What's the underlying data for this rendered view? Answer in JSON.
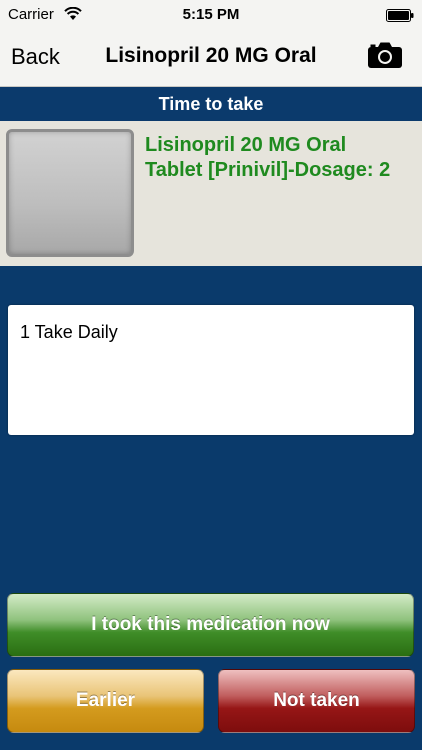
{
  "status_bar": {
    "carrier": "Carrier",
    "time": "5:15 PM"
  },
  "nav": {
    "back_label": "Back",
    "title": "Lisinopril 20 MG Oral",
    "camera_icon": "camera-icon"
  },
  "section": {
    "header": "Time to take"
  },
  "medication": {
    "name_line1": "Lisinopril 20 MG Oral",
    "name_line2": "Tablet [Prinivil]-Dosage: 2",
    "name_color": "#1f8a1f"
  },
  "instructions": {
    "text": "1 Take Daily"
  },
  "actions": {
    "took_label": "I took this medication now",
    "earlier_label": "Earlier",
    "not_taken_label": "Not taken"
  },
  "colors": {
    "background": "#0a3a6b",
    "took": "#3f8d28",
    "earlier": "#d49b1e",
    "not_taken": "#961616"
  }
}
